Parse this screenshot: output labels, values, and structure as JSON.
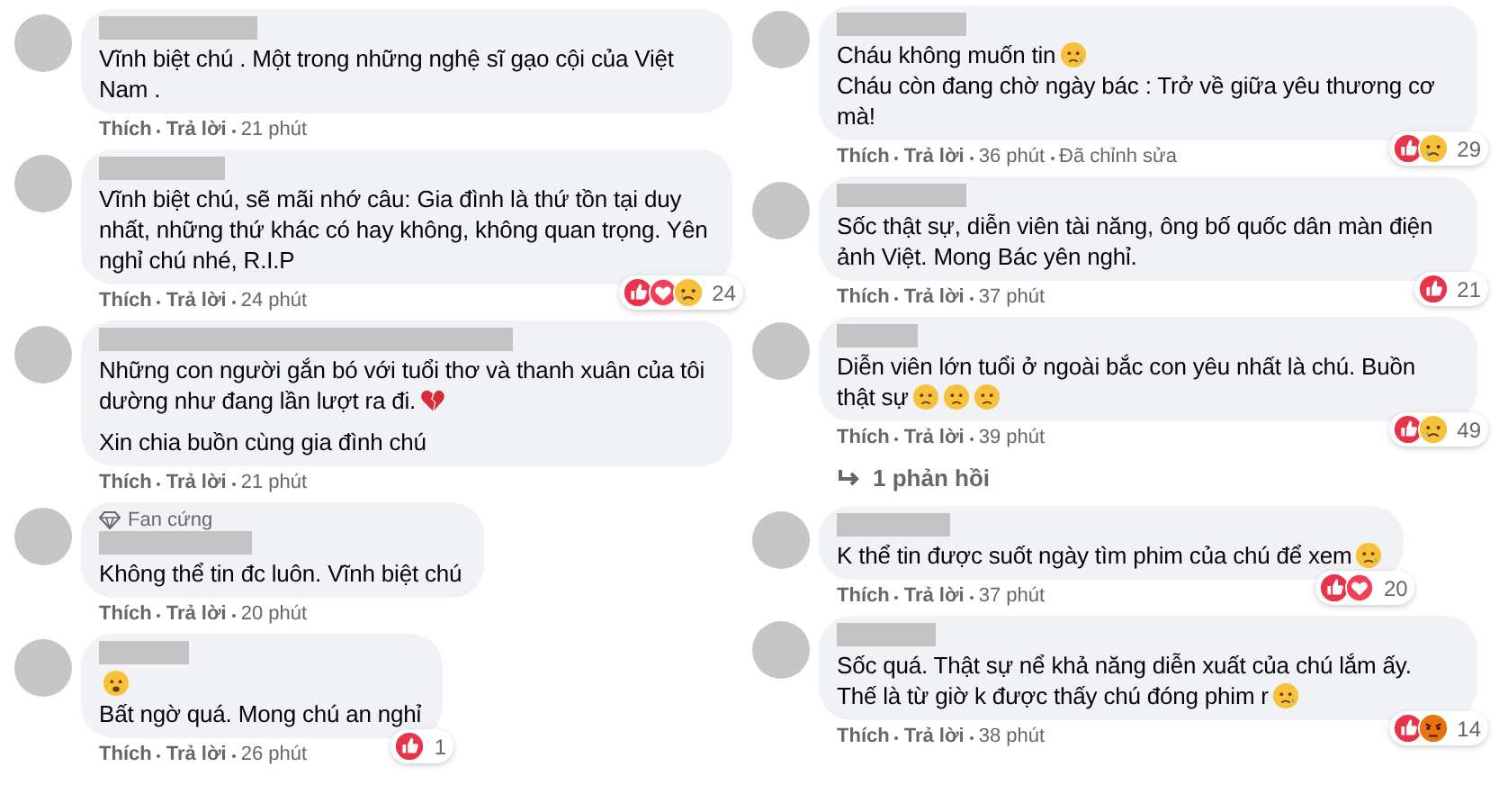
{
  "columns": [
    {
      "comments": [
        {
          "lines": [
            {
              "text": "Vĩnh biệt chú . Một trong những nghệ sĩ gạo cội của Việt Nam ."
            }
          ],
          "actions": [
            "Thích",
            "Trả lời"
          ],
          "time": "21 phút"
        },
        {
          "lines": [
            {
              "text": "Vĩnh biệt chú, sẽ mãi nhớ câu: Gia đình là thứ tồn tại duy nhất, những thứ khác có hay không, không quan trọng. Yên nghỉ chú nhé, R.I.P"
            }
          ],
          "reactions": [
            {
              "kind": "like"
            },
            {
              "kind": "love"
            },
            {
              "kind": "sad"
            }
          ],
          "reaction_count": "24",
          "actions": [
            "Thích",
            "Trả lời"
          ],
          "time": "24 phút"
        },
        {
          "lines": [
            {
              "text": "Những con người gắn bó với tuổi thơ và thanh xuân của tôi dường như đang lần lượt ra đi.",
              "emoji": [
                {
                  "kind": "brokenheart"
                }
              ]
            },
            {
              "text": "Xin chia buồn cùng gia đình chú",
              "gap": true
            }
          ],
          "actions": [
            "Thích",
            "Trả lời"
          ],
          "time": "21 phút"
        },
        {
          "badge": "Fan cứng",
          "lines": [
            {
              "text": "Không thể tin đc luôn. Vĩnh biệt chú"
            }
          ],
          "actions": [
            "Thích",
            "Trả lời"
          ],
          "time": "20 phút"
        },
        {
          "lines": [
            {
              "emoji": [
                {
                  "kind": "shocked"
                }
              ]
            },
            {
              "text": "Bất ngờ quá. Mong chú an nghỉ"
            }
          ],
          "reactions": [
            {
              "kind": "like"
            }
          ],
          "reaction_count": "1",
          "actions": [
            "Thích",
            "Trả lời"
          ],
          "time": "26 phút"
        }
      ]
    },
    {
      "comments": [
        {
          "lines": [
            {
              "text": "Cháu không muốn tin",
              "emoji": [
                {
                  "kind": "cry"
                }
              ]
            },
            {
              "text": "Cháu còn đang chờ ngày bác : Trở về giữa yêu thương cơ mà!"
            }
          ],
          "reactions": [
            {
              "kind": "like"
            },
            {
              "kind": "sad"
            }
          ],
          "reaction_count": "29",
          "actions": [
            "Thích",
            "Trả lời"
          ],
          "time": "36 phút",
          "edited": "Đã chỉnh sửa"
        },
        {
          "lines": [
            {
              "text": "Sốc thật sự, diễn viên tài năng, ông bố quốc dân màn điện ảnh Việt. Mong Bác yên nghỉ."
            }
          ],
          "reactions": [
            {
              "kind": "like"
            }
          ],
          "reaction_count": "21",
          "actions": [
            "Thích",
            "Trả lời"
          ],
          "time": "37 phút"
        },
        {
          "lines": [
            {
              "text": "Diễn viên lớn tuổi ở ngoài bắc con yêu nhất là chú. Buồn thật sự",
              "emoji": [
                {
                  "kind": "pensive"
                },
                {
                  "kind": "pensive"
                },
                {
                  "kind": "pensive"
                }
              ]
            }
          ],
          "reactions": [
            {
              "kind": "like"
            },
            {
              "kind": "sad"
            }
          ],
          "reaction_count": "49",
          "actions": [
            "Thích",
            "Trả lời"
          ],
          "time": "39 phút",
          "replies": "1 phản hồi"
        },
        {
          "lines": [
            {
              "text": "K thể tin được suốt ngày tìm phim của chú để xem",
              "emoji": [
                {
                  "kind": "sweat"
                }
              ]
            }
          ],
          "reactions": [
            {
              "kind": "like"
            },
            {
              "kind": "love"
            }
          ],
          "reaction_count": "20",
          "actions": [
            "Thích",
            "Trả lời"
          ],
          "time": "37 phút"
        },
        {
          "lines": [
            {
              "text": "Sốc quá. Thật sự nể khả năng diễn xuất của chú lắm ấy. Thế là từ giờ k được thấy chú đóng phim r",
              "emoji": [
                {
                  "kind": "cry"
                }
              ]
            }
          ],
          "reactions": [
            {
              "kind": "like"
            },
            {
              "kind": "angry"
            }
          ],
          "reaction_count": "14",
          "actions": [
            "Thích",
            "Trả lời"
          ],
          "time": "38 phút"
        }
      ]
    }
  ]
}
